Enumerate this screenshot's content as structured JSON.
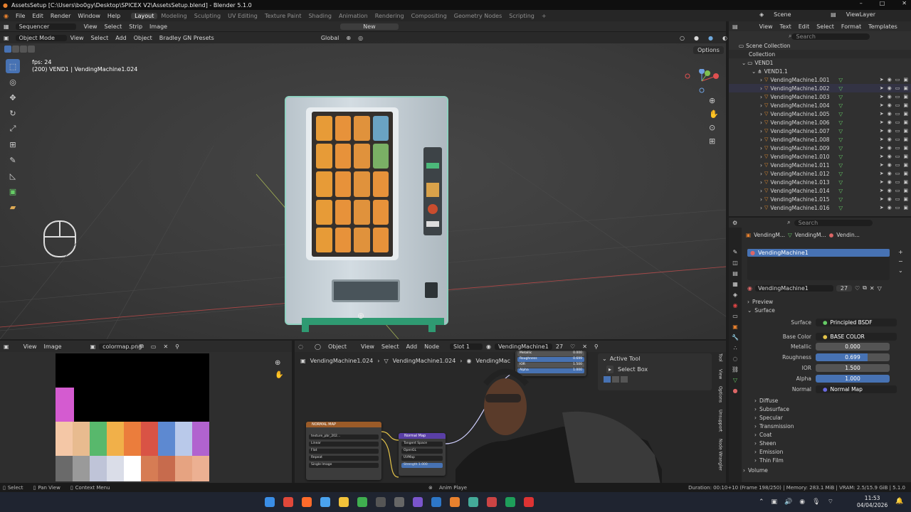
{
  "title_bar": {
    "text": "AssetsSetup [C:\\Users\\bo0gy\\Desktop\\SPICEX V2\\AssetsSetup.blend] - Blender 5.1.0"
  },
  "menu": {
    "items": [
      "File",
      "Edit",
      "Render",
      "Window",
      "Help"
    ]
  },
  "workspaces": [
    "Layout",
    "Modeling",
    "Sculpting",
    "UV Editing",
    "Texture Paint",
    "Shading",
    "Animation",
    "Rendering",
    "Compositing",
    "Geometry Nodes",
    "Scripting"
  ],
  "top_right": {
    "scene": "Scene",
    "view_layer": "ViewLayer"
  },
  "sequencer_header": {
    "editor": "Sequencer",
    "menus": [
      "View",
      "Select",
      "Strip",
      "Image"
    ],
    "new_label": "New"
  },
  "viewport": {
    "mode": "Object Mode",
    "menus": [
      "View",
      "Select",
      "Add",
      "Object",
      "Bradley GN Presets"
    ],
    "orientation": "Global",
    "options": "Options",
    "fps": "fps: 24",
    "info": "(200) VEND1 | VendingMachine1.024"
  },
  "outliner": {
    "menus": [
      "View",
      "Text",
      "Edit",
      "Select",
      "Format",
      "Templates"
    ],
    "search_placeholder": "Search",
    "scene_collection": "Scene Collection",
    "collection": "Collection",
    "vend1": "VEND1",
    "vend1_1": "VEND1.1",
    "items": [
      "VendingMachine1.001",
      "VendingMachine1.002",
      "VendingMachine1.003",
      "VendingMachine1.004",
      "VendingMachine1.005",
      "VendingMachine1.006",
      "VendingMachine1.007",
      "VendingMachine1.008",
      "VendingMachine1.009",
      "VendingMachine1.010",
      "VendingMachine1.011",
      "VendingMachine1.012",
      "VendingMachine1.013",
      "VendingMachine1.014",
      "VendingMachine1.015",
      "VendingMachine1.016"
    ]
  },
  "properties": {
    "search_placeholder": "Search",
    "breadcrumb": [
      "VendingM...",
      "VendingM...",
      "Vendin..."
    ],
    "slot_selected": "VendingMachine1",
    "material_name": "VendingMachine1",
    "users": "27",
    "preview": "Preview",
    "surface": "Surface",
    "surface_label": "Surface",
    "surface_value": "Principled BSDF",
    "base_color_label": "Base Color",
    "base_color_value": "BASE COLOR",
    "metallic_label": "Metallic",
    "metallic_value": "0.000",
    "roughness_label": "Roughness",
    "roughness_value": "0.699",
    "roughness_fraction": 0.699,
    "ior_label": "IOR",
    "ior_value": "1.500",
    "alpha_label": "Alpha",
    "alpha_value": "1.000",
    "normal_label": "Normal",
    "normal_value": "Normal Map",
    "sections": [
      "Diffuse",
      "Subsurface",
      "Specular",
      "Transmission",
      "Coat",
      "Sheen",
      "Emission",
      "Thin Film"
    ],
    "volume": "Volume"
  },
  "image_editor": {
    "menus": [
      "View",
      "Image"
    ],
    "image_name": "colormap.png"
  },
  "node_editor": {
    "object": "Object",
    "menus": [
      "View",
      "Select",
      "Add",
      "Node"
    ],
    "slot": "Slot 1",
    "material": "VendingMachine1",
    "users": "27",
    "breadcrumb": [
      "VendingMachine1.024",
      "VendingMachine1.024",
      "VendingMac"
    ],
    "active_tool_title": "Active Tool",
    "active_tool": "Select Box",
    "side_tabs": [
      "Tool",
      "View",
      "Options",
      "Unsupport",
      "Node Wrangler"
    ],
    "node1_title": "NORMAL MAP",
    "node2_title": "Normal Map",
    "node2_fields": [
      "Tangent Space",
      "OpenGL",
      "UVMap",
      "Strength  1.000"
    ],
    "node1_fields": [
      "texture_pbr_202...",
      "Linear",
      "Flat",
      "Repeat",
      "Single Image"
    ],
    "tiny_labels": [
      "Metallic",
      "Roughness",
      "IOR",
      "Alpha"
    ],
    "tiny_values": [
      "0.000",
      "0.699",
      "1.500",
      "1.000"
    ]
  },
  "status_bar": {
    "left": [
      "Select",
      "Pan View",
      "Context Menu"
    ],
    "anim": "Anim Playe",
    "right": "Duration: 00:10+10 (Frame 198/250) | Memory: 283.1 MiB | VRAM: 2.5/15.9 GiB | 5.1.0"
  },
  "taskbar": {
    "time": "11:53",
    "date": "04/04/2026"
  }
}
